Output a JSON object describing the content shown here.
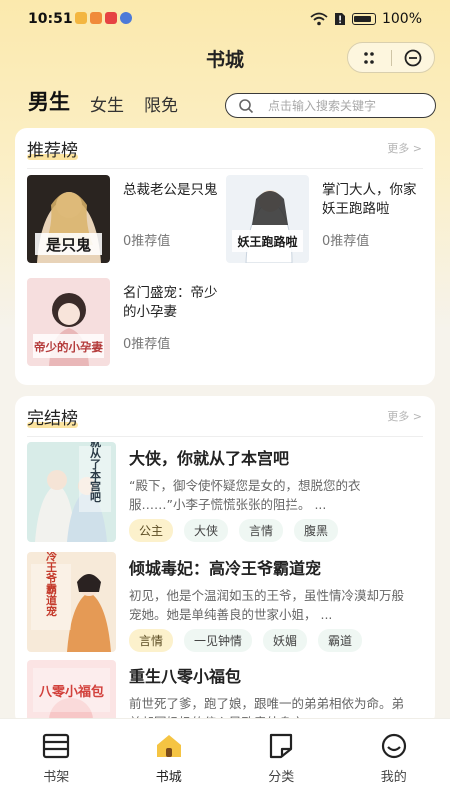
{
  "status_bar": {
    "time": "10:51",
    "battery": "100%"
  },
  "header": {
    "title": "书城"
  },
  "tabs": [
    {
      "label": "男生",
      "active": true
    },
    {
      "label": "女生",
      "active": false
    },
    {
      "label": "限免",
      "active": false
    }
  ],
  "search": {
    "placeholder": "点击输入搜索关键字"
  },
  "recommend": {
    "title": "推荐榜",
    "more": "更多 >",
    "books": [
      {
        "name": "总裁老公是只鬼",
        "count": "0推荐值",
        "cover_text": "是只鬼"
      },
      {
        "name": "掌门大人，你家妖王跑路啦",
        "count": "0推荐值",
        "cover_text": "妖王跑路啦"
      },
      {
        "name": "名门盛宠：帝少的小孕妻",
        "count": "0推荐值",
        "cover_text": "帝少的小孕妻"
      }
    ]
  },
  "finished": {
    "title": "完结榜",
    "more": "更多 >",
    "books": [
      {
        "name": "大侠，你就从了本宫吧",
        "desc": "“殿下，御令使怀疑您是女的，想脱您的衣服……”小李子慌慌张张的阻拦。 ...",
        "tags": [
          "公主",
          "大侠",
          "言情",
          "腹黑"
        ],
        "cover_text": "你就从了本宫吧"
      },
      {
        "name": "倾城毒妃：高冷王爷霸道宠",
        "desc": "初见，他是个温润如玉的王爷，虽性情冷漠却万般宠她。她是单纯善良的世家小姐， ...",
        "tags": [
          "言情",
          "一见钟情",
          "妖媚",
          "霸道"
        ],
        "cover_text": "高冷王爷霸道宠"
      },
      {
        "name": "重生八零小福包",
        "desc": "前世死了爹，跑了娘，跟唯一的弟弟相依为命。弟弟却因奶奶的偏心导致意外身亡。 ...",
        "tags": [],
        "cover_text": "八零小福包"
      }
    ]
  },
  "tabbar": [
    {
      "label": "书架",
      "icon": "bookshelf-icon"
    },
    {
      "label": "书城",
      "icon": "bookstore-house-icon",
      "active": true
    },
    {
      "label": "分类",
      "icon": "category-icon"
    },
    {
      "label": "我的",
      "icon": "profile-icon"
    }
  ],
  "colors": {
    "accent": "#f5c443",
    "tag_highlight": "#fcf1cc",
    "tag_default": "#eff7f3"
  }
}
